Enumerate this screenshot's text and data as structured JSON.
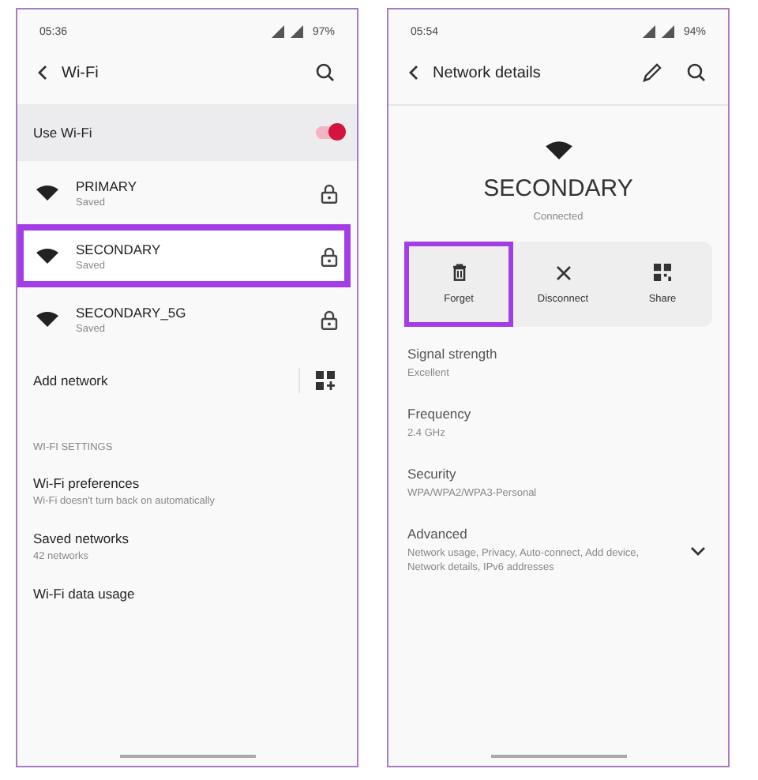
{
  "wifi_screen": {
    "status_bar": {
      "time": "05:36",
      "battery": "97%"
    },
    "title": "Wi-Fi",
    "use_wifi": {
      "label": "Use Wi-Fi",
      "on": true
    },
    "networks": [
      {
        "name": "PRIMARY",
        "status": "Saved",
        "highlighted": false
      },
      {
        "name": "SECONDARY",
        "status": "Saved",
        "highlighted": true
      },
      {
        "name": "SECONDARY_5G",
        "status": "Saved",
        "highlighted": false
      }
    ],
    "add_network": "Add network",
    "section_header": "WI-FI SETTINGS",
    "settings": [
      {
        "title": "Wi-Fi preferences",
        "subtitle": "Wi-Fi doesn't turn back on automatically"
      },
      {
        "title": "Saved networks",
        "subtitle": "42 networks"
      },
      {
        "title": "Wi-Fi data usage"
      }
    ]
  },
  "details_screen": {
    "status_bar": {
      "time": "05:54",
      "battery": "94%"
    },
    "title": "Network details",
    "network_name": "SECONDARY",
    "network_status": "Connected",
    "actions": [
      {
        "kind": "forget",
        "label": "Forget",
        "highlighted": true
      },
      {
        "kind": "disconnect",
        "label": "Disconnect",
        "highlighted": false
      },
      {
        "kind": "share",
        "label": "Share",
        "highlighted": false
      }
    ],
    "details": [
      {
        "title": "Signal strength",
        "value": "Excellent"
      },
      {
        "title": "Frequency",
        "value": "2.4 GHz"
      },
      {
        "title": "Security",
        "value": "WPA/WPA2/WPA3-Personal"
      },
      {
        "title": "Advanced",
        "value": "Network usage, Privacy, Auto-connect, Add device, Network details, IPv6 addresses",
        "expandable": true
      }
    ]
  }
}
